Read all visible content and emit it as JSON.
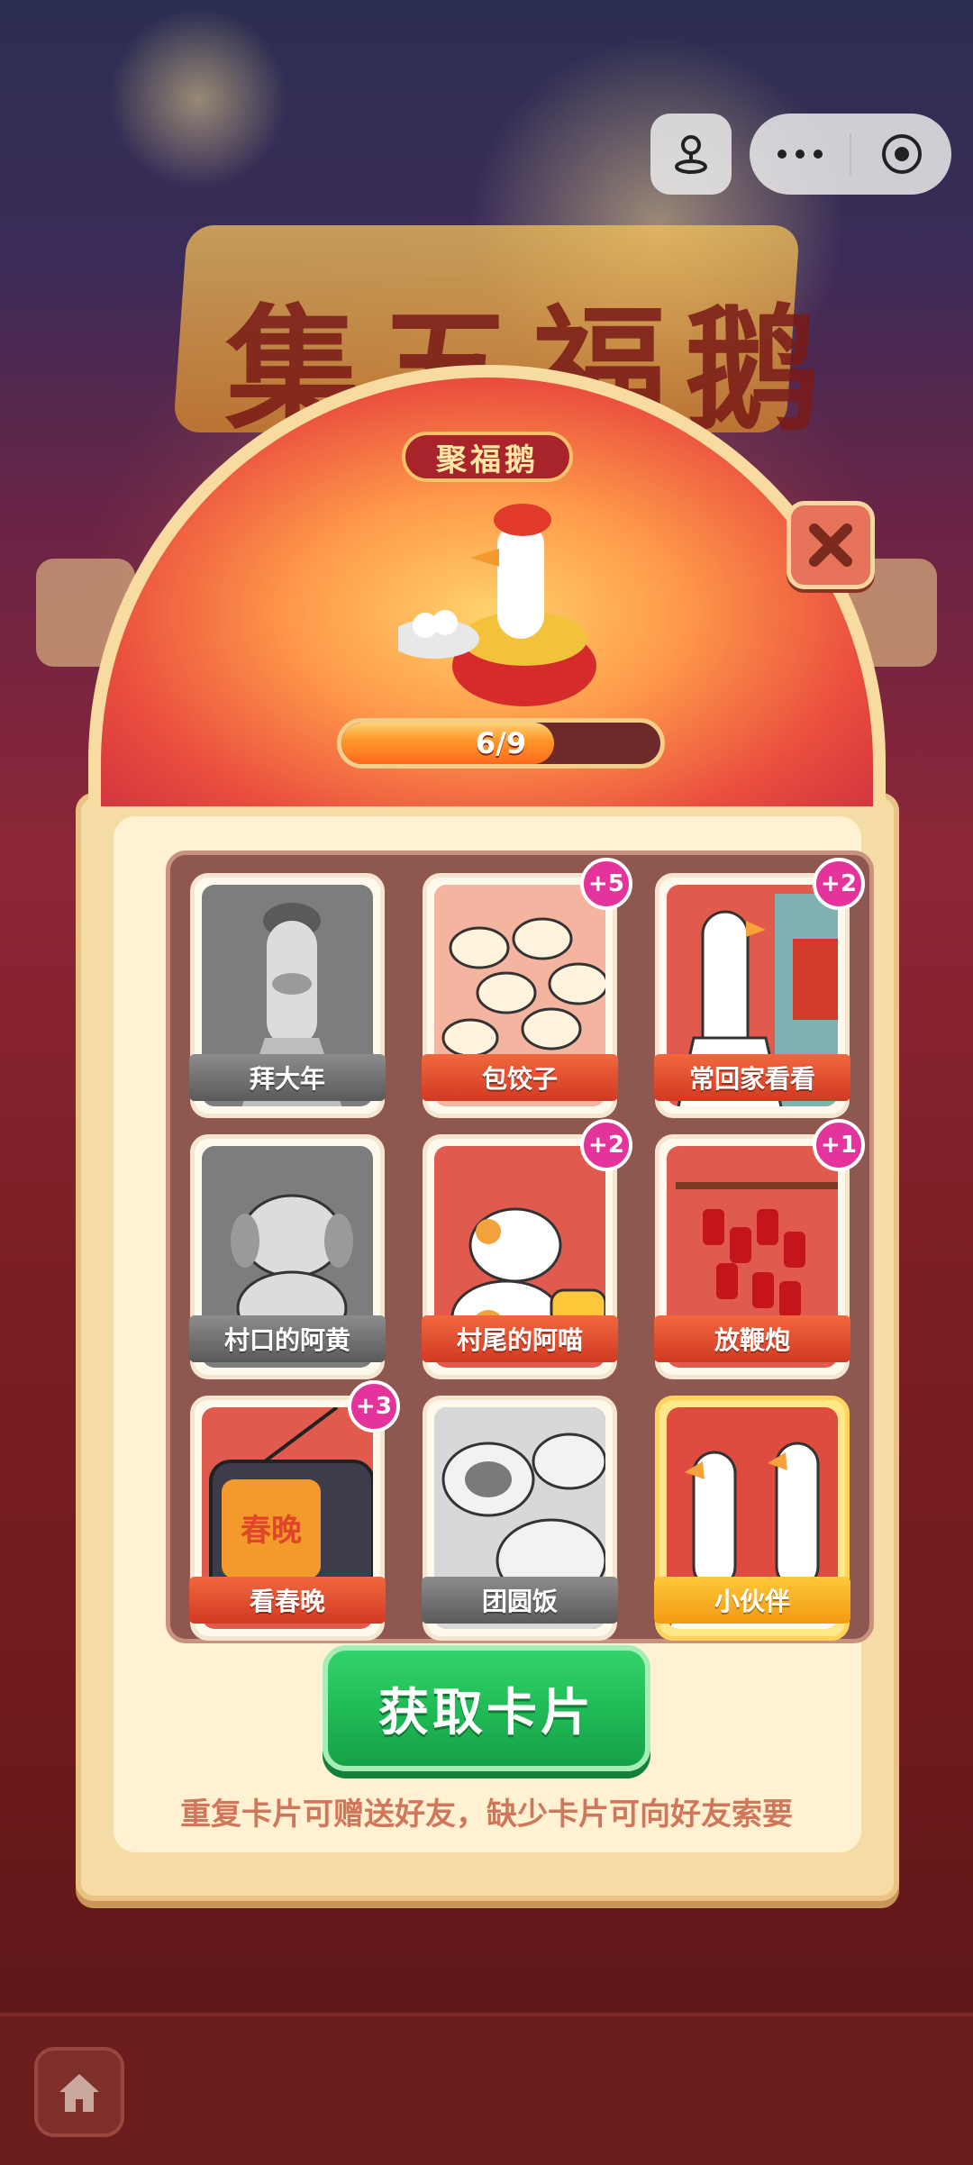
{
  "background": {
    "title": "集五福鹅"
  },
  "panel": {
    "title": "聚福鹅",
    "progress": {
      "text": "6/9",
      "current": 6,
      "total": 9
    }
  },
  "cards": [
    {
      "label": "拜大年",
      "style": "gray",
      "badge": ""
    },
    {
      "label": "包饺子",
      "style": "red",
      "badge": "+5"
    },
    {
      "label": "常回家看看",
      "style": "red",
      "badge": "+2"
    },
    {
      "label": "村口的阿黄",
      "style": "gray",
      "badge": ""
    },
    {
      "label": "村尾的阿喵",
      "style": "red",
      "badge": "+2"
    },
    {
      "label": "放鞭炮",
      "style": "red",
      "badge": "+1"
    },
    {
      "label": "看春晚",
      "style": "red",
      "badge": "+3"
    },
    {
      "label": "团圆饭",
      "style": "gray",
      "badge": ""
    },
    {
      "label": "小伙伴",
      "style": "gold",
      "badge": ""
    }
  ],
  "card_art": {
    "tv_text": "春晚"
  },
  "actions": {
    "get_cards": "获取卡片",
    "hint": "重复卡片可赠送好友，缺少卡片可向好友索要"
  },
  "colors": {
    "accent_green": "#1fb955",
    "badge_pink": "#e4349b",
    "panel_red": "#c92c3f",
    "card_red": "#e05a4e"
  },
  "icons": {
    "top_left": "person-pin-icon",
    "more": "more-dots-icon",
    "close_mini": "target-icon",
    "close": "close-icon",
    "home": "home-icon"
  }
}
